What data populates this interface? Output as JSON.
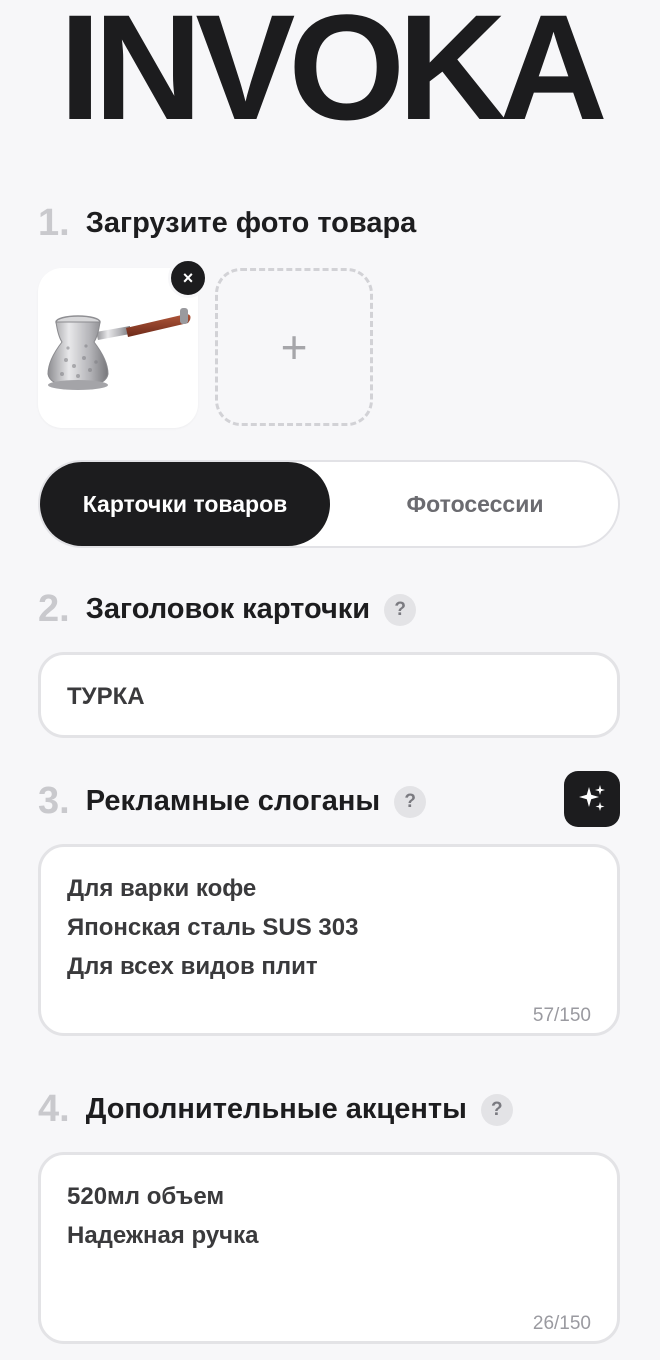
{
  "app": {
    "logo": "INVOKA"
  },
  "step1": {
    "number": "1.",
    "title": "Загрузите фото товара",
    "remove_label": "×",
    "add_label": "+"
  },
  "mode": {
    "active": "Карточки товаров",
    "inactive": "Фотосессии"
  },
  "step2": {
    "number": "2.",
    "title": "Заголовок карточки",
    "help": "?",
    "value": "ТУРКА"
  },
  "step3": {
    "number": "3.",
    "title": "Рекламные слоганы",
    "help": "?",
    "lines": [
      "Для варки кофе",
      "Японская сталь SUS 303",
      "Для всех видов плит"
    ],
    "counter": "57/150"
  },
  "step4": {
    "number": "4.",
    "title": "Дополнительные акценты",
    "help": "?",
    "lines": [
      "520мл объем",
      "Надежная ручка"
    ],
    "counter": "26/150"
  },
  "colors": {
    "accent": "#1c1c1e",
    "background": "#f7f7f9",
    "muted": "#c9c9cd"
  }
}
